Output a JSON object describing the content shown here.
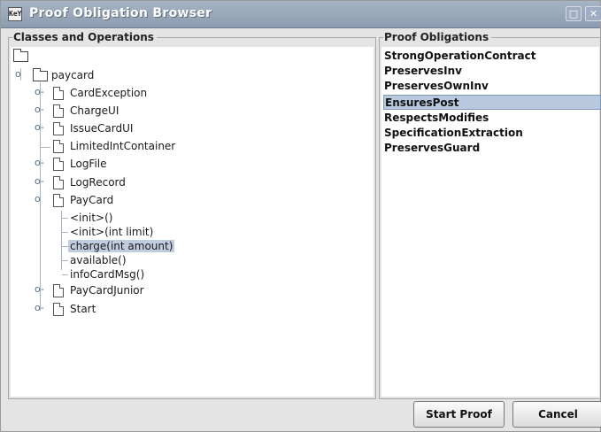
{
  "window": {
    "title": "Proof Obligation Browser",
    "app_icon_text": "KeY"
  },
  "left_panel": {
    "title": "Classes and Operations",
    "tree": {
      "package": "paycard",
      "classes": [
        "CardException",
        "ChargeUI",
        "IssueCardUI",
        "LimitedIntContainer",
        "LogFile",
        "LogRecord",
        "PayCard",
        "PayCardJunior",
        "Start"
      ],
      "paycard_operations": [
        "<init>()",
        "<init>(int limit)",
        "charge(int amount)",
        "available()",
        "infoCardMsg()"
      ],
      "selected_operation": "charge(int amount)"
    }
  },
  "right_panel": {
    "title": "Proof Obligations",
    "items": [
      "StrongOperationContract",
      "PreservesInv",
      "PreservesOwnInv",
      "EnsuresPost",
      "RespectsModifies",
      "SpecificationExtraction",
      "PreservesGuard"
    ],
    "selected_item": "EnsuresPost"
  },
  "buttons": {
    "start_proof": "Start Proof",
    "cancel": "Cancel"
  }
}
